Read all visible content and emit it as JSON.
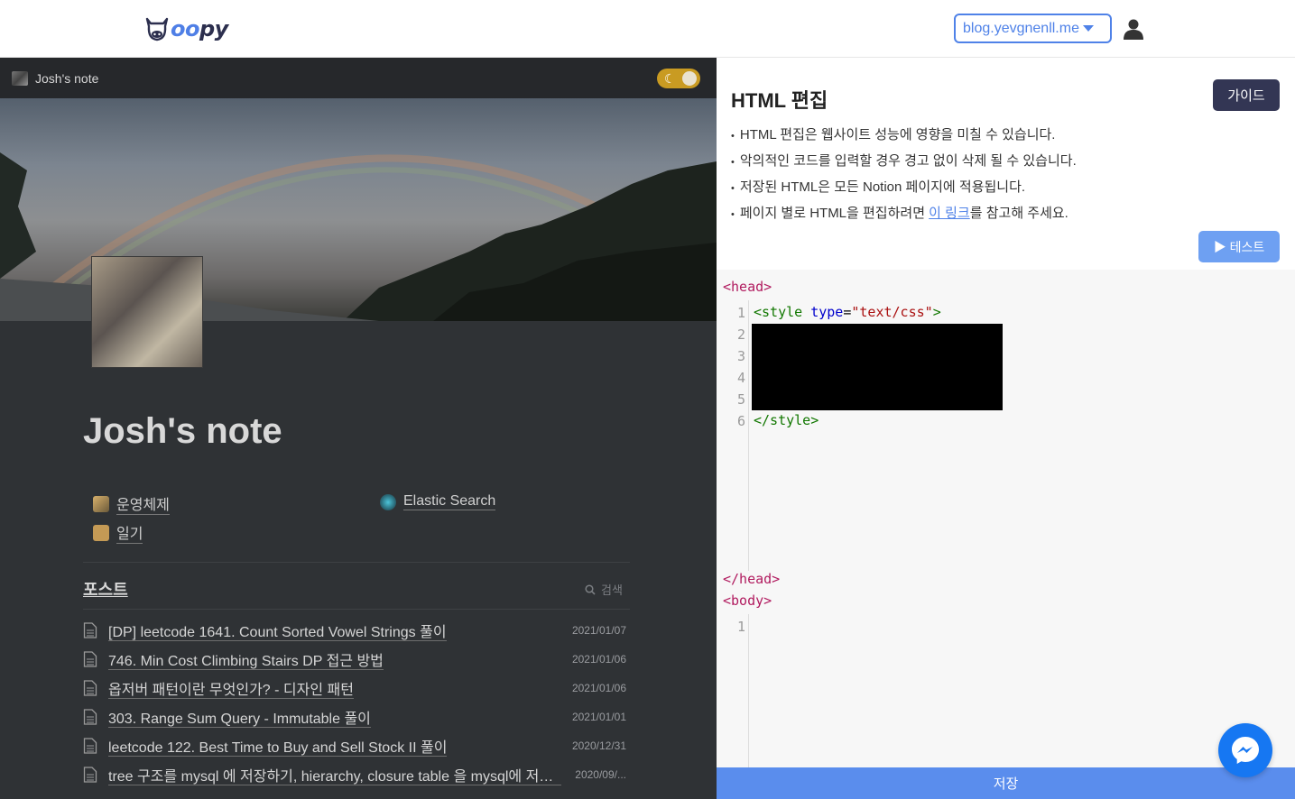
{
  "header": {
    "logo_text_a": "oo",
    "logo_text_b": "py",
    "site_selector": "blog.yevgnenll.me",
    "accent": "#4f82e8"
  },
  "preview": {
    "tab_title": "Josh's note",
    "page_title": "Josh's note",
    "links": [
      {
        "label": "운영체제"
      },
      {
        "label": "일기"
      },
      {
        "label": "Elastic Search"
      }
    ],
    "posts_heading": "포스트",
    "search_label": "검색",
    "posts": [
      {
        "title": "[DP] leetcode 1641. Count Sorted Vowel Strings 풀이",
        "date": "2021/01/07"
      },
      {
        "title": "746. Min Cost Climbing Stairs DP 접근 방법",
        "date": "2021/01/06"
      },
      {
        "title": "옵저버 패턴이란 무엇인가? - 디자인 패턴",
        "date": "2021/01/06"
      },
      {
        "title": "303. Range Sum Query - Immutable 풀이",
        "date": "2021/01/01"
      },
      {
        "title": "leetcode 122. Best Time to Buy and Sell Stock II 풀이",
        "date": "2020/12/31"
      },
      {
        "title": "tree 구조를 mysql 에 저장하기, hierarchy, closure table 을 mysql에 저장하는 방법",
        "date": "2020/09/..."
      }
    ]
  },
  "editor": {
    "title": "HTML 편집",
    "guide_label": "가이드",
    "notes": [
      "HTML 편집은 웹사이트 성능에 영향을 미칠 수 있습니다.",
      "악의적인 코드를 입력할 경우 경고 없이 삭제 될 수 있습니다.",
      "저장된 HTML은 모든 Notion 페이지에 적용됩니다."
    ],
    "note_link_prefix": "페이지 별로 HTML을 편집하려면 ",
    "note_link_text": "이 링크",
    "note_link_suffix": "를 참고해 주세요.",
    "test_label": "▶ 테스트",
    "head_open": "<head>",
    "head_close": "</head>",
    "body_open": "<body>",
    "head_lines": [
      "1",
      "2",
      "3",
      "4",
      "5",
      "6"
    ],
    "code_style_open_tag": "<style",
    "code_style_attr": "type",
    "code_style_eq": "=",
    "code_style_val": "\"text/css\"",
    "code_style_close_bracket": ">",
    "code_style_close": "</style>",
    "body_lines": [
      "1"
    ],
    "save_label": "저장"
  }
}
